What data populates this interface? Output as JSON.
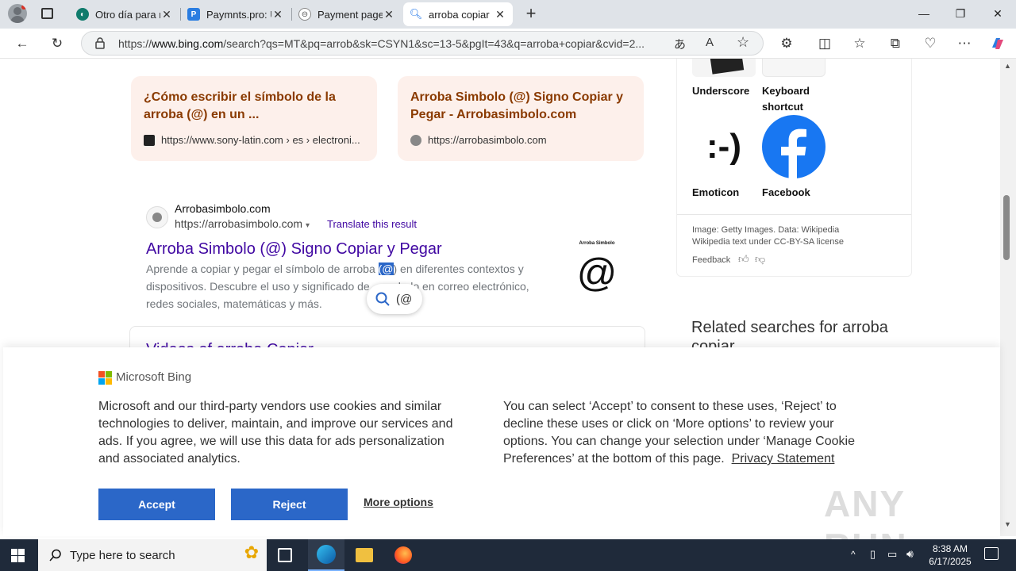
{
  "browser": {
    "tabs": [
      {
        "title": "Otro día para r",
        "favicon": "copilot-icon",
        "active": false
      },
      {
        "title": "Paymnts.pro: U",
        "favicon": "p-icon",
        "active": false
      },
      {
        "title": "Payment page",
        "favicon": "page-icon",
        "active": false
      },
      {
        "title": "arroba copiar",
        "favicon": "search-icon",
        "active": true
      }
    ],
    "url_prefix": "https://",
    "url_host": "www.bing.com",
    "url_rest": "/search?qs=MT&pq=arrob&sk=CSYN1&sc=13-5&pgIt=43&q=arroba+copiar&cvid=2..."
  },
  "cards": [
    {
      "title": "¿Cómo escribir el símbolo de la arroba (@) en un ...",
      "url": "https://www.sony-latin.com › es › electroni..."
    },
    {
      "title": "Arroba Simbolo (@) Signo Copiar y Pegar - Arrobasimbolo.com",
      "url": "https://arrobasimbolo.com"
    }
  ],
  "result": {
    "site": "Arrobasimbolo.com",
    "url": "https://arrobasimbolo.com",
    "translate": "Translate this result",
    "title": "Arroba Simbolo (@) Signo Copiar y Pegar",
    "snippet_1a": "Aprende a copiar y pegar el símbolo de arroba ",
    "snippet_1sel": "(@",
    "snippet_1b": ") en diferentes contextos y",
    "snippet_2a": "dispositivos. Descubre el uso y significado de",
    "snippet_2b": "bolo en correo electrónico,",
    "snippet_3": "redes sociales, matemáticas y más.",
    "thumb_title": "Arroba Simbolo",
    "thumb_symbol": "@",
    "popup_text": "(@"
  },
  "videos_heading": "Videos of arroba Copiar",
  "knowledge_panel": {
    "items": [
      {
        "label": "Underscore"
      },
      {
        "label": "Keyboard shortcut"
      },
      {
        "label": "Emoticon",
        "glyph": ":-)"
      },
      {
        "label": "Facebook"
      }
    ],
    "attribution_1": "Image: Getty Images. Data: Wikipedia",
    "attribution_2": "Wikipedia text under CC-BY-SA license",
    "feedback": "Feedback"
  },
  "related_heading": "Related searches for arroba copiar",
  "cookie": {
    "brand": "Microsoft Bing",
    "left_text": "Microsoft and our third-party vendors use cookies and similar technologies to deliver, maintain, and improve our services and ads. If you agree, we will use this data for ads personalization and associated analytics.",
    "right_text": "You can select ‘Accept’ to consent to these uses, ‘Reject’ to decline these uses or click on ‘More options’ to review your options. You can change your selection under ‘Manage Cookie Preferences’ at the bottom of this page.",
    "privacy_link": "Privacy Statement",
    "accept": "Accept",
    "reject": "Reject",
    "more": "More options"
  },
  "watermark": "ANY RUN",
  "taskbar": {
    "search_placeholder": "Type here to search",
    "time": "8:38 AM",
    "date": "6/17/2025"
  },
  "colors": {
    "card_bg": "#fdf0eb",
    "card_title": "#8a3a00",
    "link": "#4007a2",
    "accept_blue": "#2b67c8",
    "taskbar": "#1f2a3a"
  }
}
